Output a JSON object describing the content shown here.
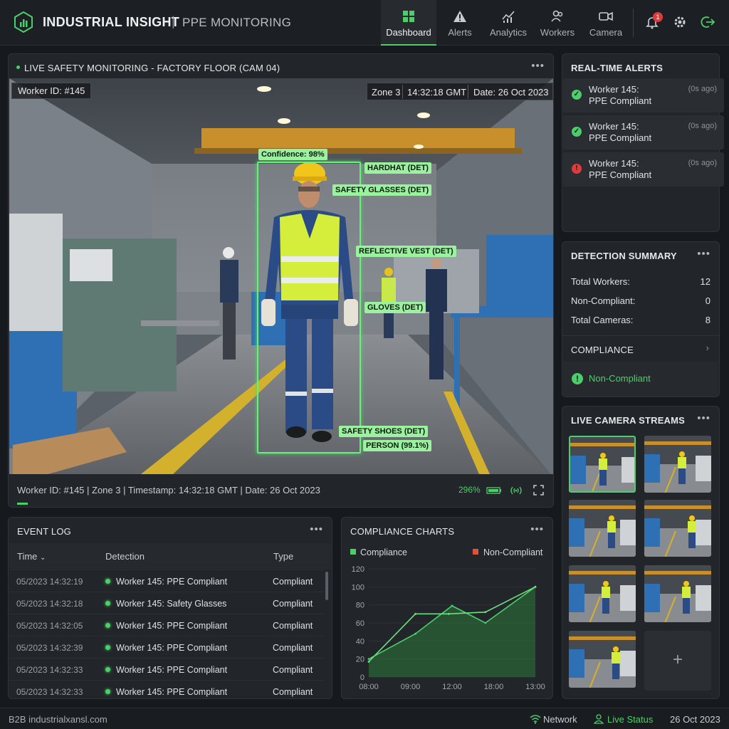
{
  "app": {
    "brand": "INDUSTRIAL INSIGHT",
    "separator": "|",
    "subtitle": "PPE MONITORING"
  },
  "nav": [
    {
      "label": "Dashboard",
      "icon": "dashboard-icon",
      "active": true
    },
    {
      "label": "Alerts",
      "icon": "warning-icon"
    },
    {
      "label": "Analytics",
      "icon": "analytics-icon"
    },
    {
      "label": "Workers",
      "icon": "workers-icon"
    },
    {
      "label": "Camera",
      "icon": "camera-icon"
    }
  ],
  "notifications": {
    "count": "1"
  },
  "live": {
    "title": "LIVE SAFETY MONITORING - FACTORY FLOOR (CAM 04)",
    "worker_overlay": "Worker ID: #145",
    "zone": "Zone 3",
    "time": "14:32:18 GMT",
    "date": "Date: 26 Oct 2023",
    "detections": {
      "confidence": "Confidence: 98%",
      "hardhat": "HARDHAT (DET)",
      "glasses": "SAFETY GLASSES (DET)",
      "vest": "REFLECTIVE VEST (DET)",
      "gloves": "GLOVES (DET)",
      "shoes": "SAFETY SHOES (DET)",
      "person": "PERSON (99.1%)"
    },
    "footer": "Worker ID: #145 | Zone 3 | Timestamp: 14:32:18 GMT | Date: 26 Oct 2023",
    "stat": "296%",
    "progress": 0.02
  },
  "alerts": {
    "title": "REAL-TIME ALERTS",
    "items": [
      {
        "line1": "Worker 145:",
        "line2": "PPE Compliant",
        "ago": "(0s ago)",
        "status": "ok"
      },
      {
        "line1": "Worker 145:",
        "line2": "PPE Compliant",
        "ago": "(0s ago)",
        "status": "ok"
      },
      {
        "line1": "Worker 145:",
        "line2": "PPE Compliant",
        "ago": "(0s ago)",
        "status": "error"
      }
    ]
  },
  "summary": {
    "title": "DETECTION SUMMARY",
    "rows": [
      {
        "label": "Total Workers:",
        "value": "12"
      },
      {
        "label": "Non-Compliant:",
        "value": "0"
      },
      {
        "label": "Total Cameras:",
        "value": "8"
      }
    ],
    "compliance_title": "COMPLIANCE",
    "compliance_status": "Non-Compliant"
  },
  "streams": {
    "title": "LIVE CAMERA STREAMS",
    "add": "+"
  },
  "event_log": {
    "title": "EVENT LOG",
    "columns": [
      "Time",
      "Detection",
      "Type"
    ],
    "rows": [
      {
        "time": "05/2023 14:32:19",
        "detection": "Worker 145: PPE Compliant",
        "type": "Compliant"
      },
      {
        "time": "05/2023 14:32:18",
        "detection": "Worker 145: Safety Glasses",
        "type": "Compliant"
      },
      {
        "time": "05/2023 14:32:05",
        "detection": "Worker 145: PPE Compliant",
        "type": "Compliant"
      },
      {
        "time": "05/2023 14:32:39",
        "detection": "Worker 145: PPE Compliant",
        "type": "Compliant"
      },
      {
        "time": "05/2023 14:32:33",
        "detection": "Worker 145: PPE Compliant",
        "type": "Compliant"
      },
      {
        "time": "05/2023 14:32:33",
        "detection": "Worker 145: PPE Compliant",
        "type": "Compliant"
      }
    ]
  },
  "charts": {
    "title": "COMPLIANCE CHARTS"
  },
  "chart_data": {
    "type": "area",
    "x": [
      "08:00",
      "09:00",
      "12:00",
      "18:00",
      "13:00"
    ],
    "ylim": [
      0,
      120
    ],
    "yticks": [
      0,
      20,
      40,
      60,
      80,
      100,
      120
    ],
    "series": [
      {
        "name": "Compliance",
        "color": "#4ccf6a",
        "points": [
          [
            0,
            20
          ],
          [
            0.28,
            48
          ],
          [
            0.5,
            79
          ],
          [
            0.7,
            60
          ],
          [
            1,
            100
          ]
        ]
      },
      {
        "name": "Non-Compliant",
        "color": "#e0533a",
        "points": [
          [
            0,
            17
          ],
          [
            0.28,
            70
          ],
          [
            0.48,
            70
          ],
          [
            0.7,
            72
          ],
          [
            1,
            100
          ]
        ]
      }
    ],
    "legend": "top"
  },
  "footer": {
    "left": "B2B industrialxansl.com",
    "network": "Network",
    "live_status": "Live Status",
    "date": "26 Oct 2023"
  }
}
